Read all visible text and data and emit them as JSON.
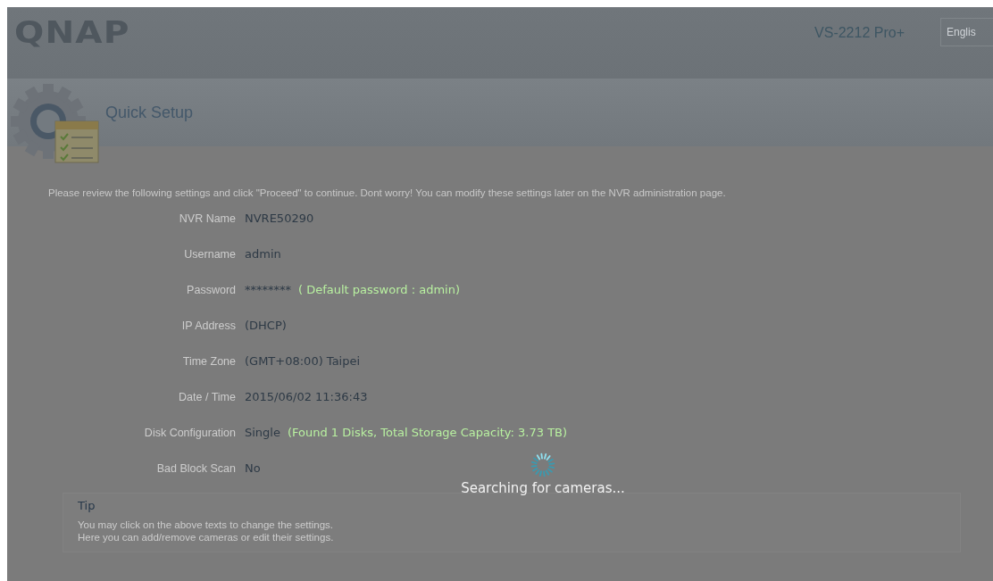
{
  "header": {
    "logo": "QNAP",
    "model": "VS-2212 Pro+",
    "language": "Englis"
  },
  "page_title": "Quick Setup",
  "intro": "Please review the following settings and click \"Proceed\" to continue. Dont worry! You can modify these settings later on the NVR administration page.",
  "settings": [
    {
      "label": "NVR Name",
      "value": "NVRE50290"
    },
    {
      "label": "Username",
      "value": "admin"
    },
    {
      "label": "Password",
      "value": "********",
      "note": "( Default password  :  admin)"
    },
    {
      "label": "IP Address",
      "value": "(DHCP)"
    },
    {
      "label": "Time Zone",
      "value": "(GMT+08:00) Taipei"
    },
    {
      "label": "Date / Time",
      "value": "2015/06/02 11:36:43"
    },
    {
      "label": "Disk Configuration",
      "value": "Single",
      "note": "(Found 1 Disks, Total Storage Capacity: 3.73 TB)"
    },
    {
      "label": "Bad Block Scan",
      "value": "No"
    }
  ],
  "overlay": {
    "message": "Searching for cameras..."
  },
  "tip": {
    "title": "Tip",
    "lines": [
      "You may click on the above texts to change the settings.",
      "Here you can add/remove cameras or edit their settings."
    ]
  }
}
